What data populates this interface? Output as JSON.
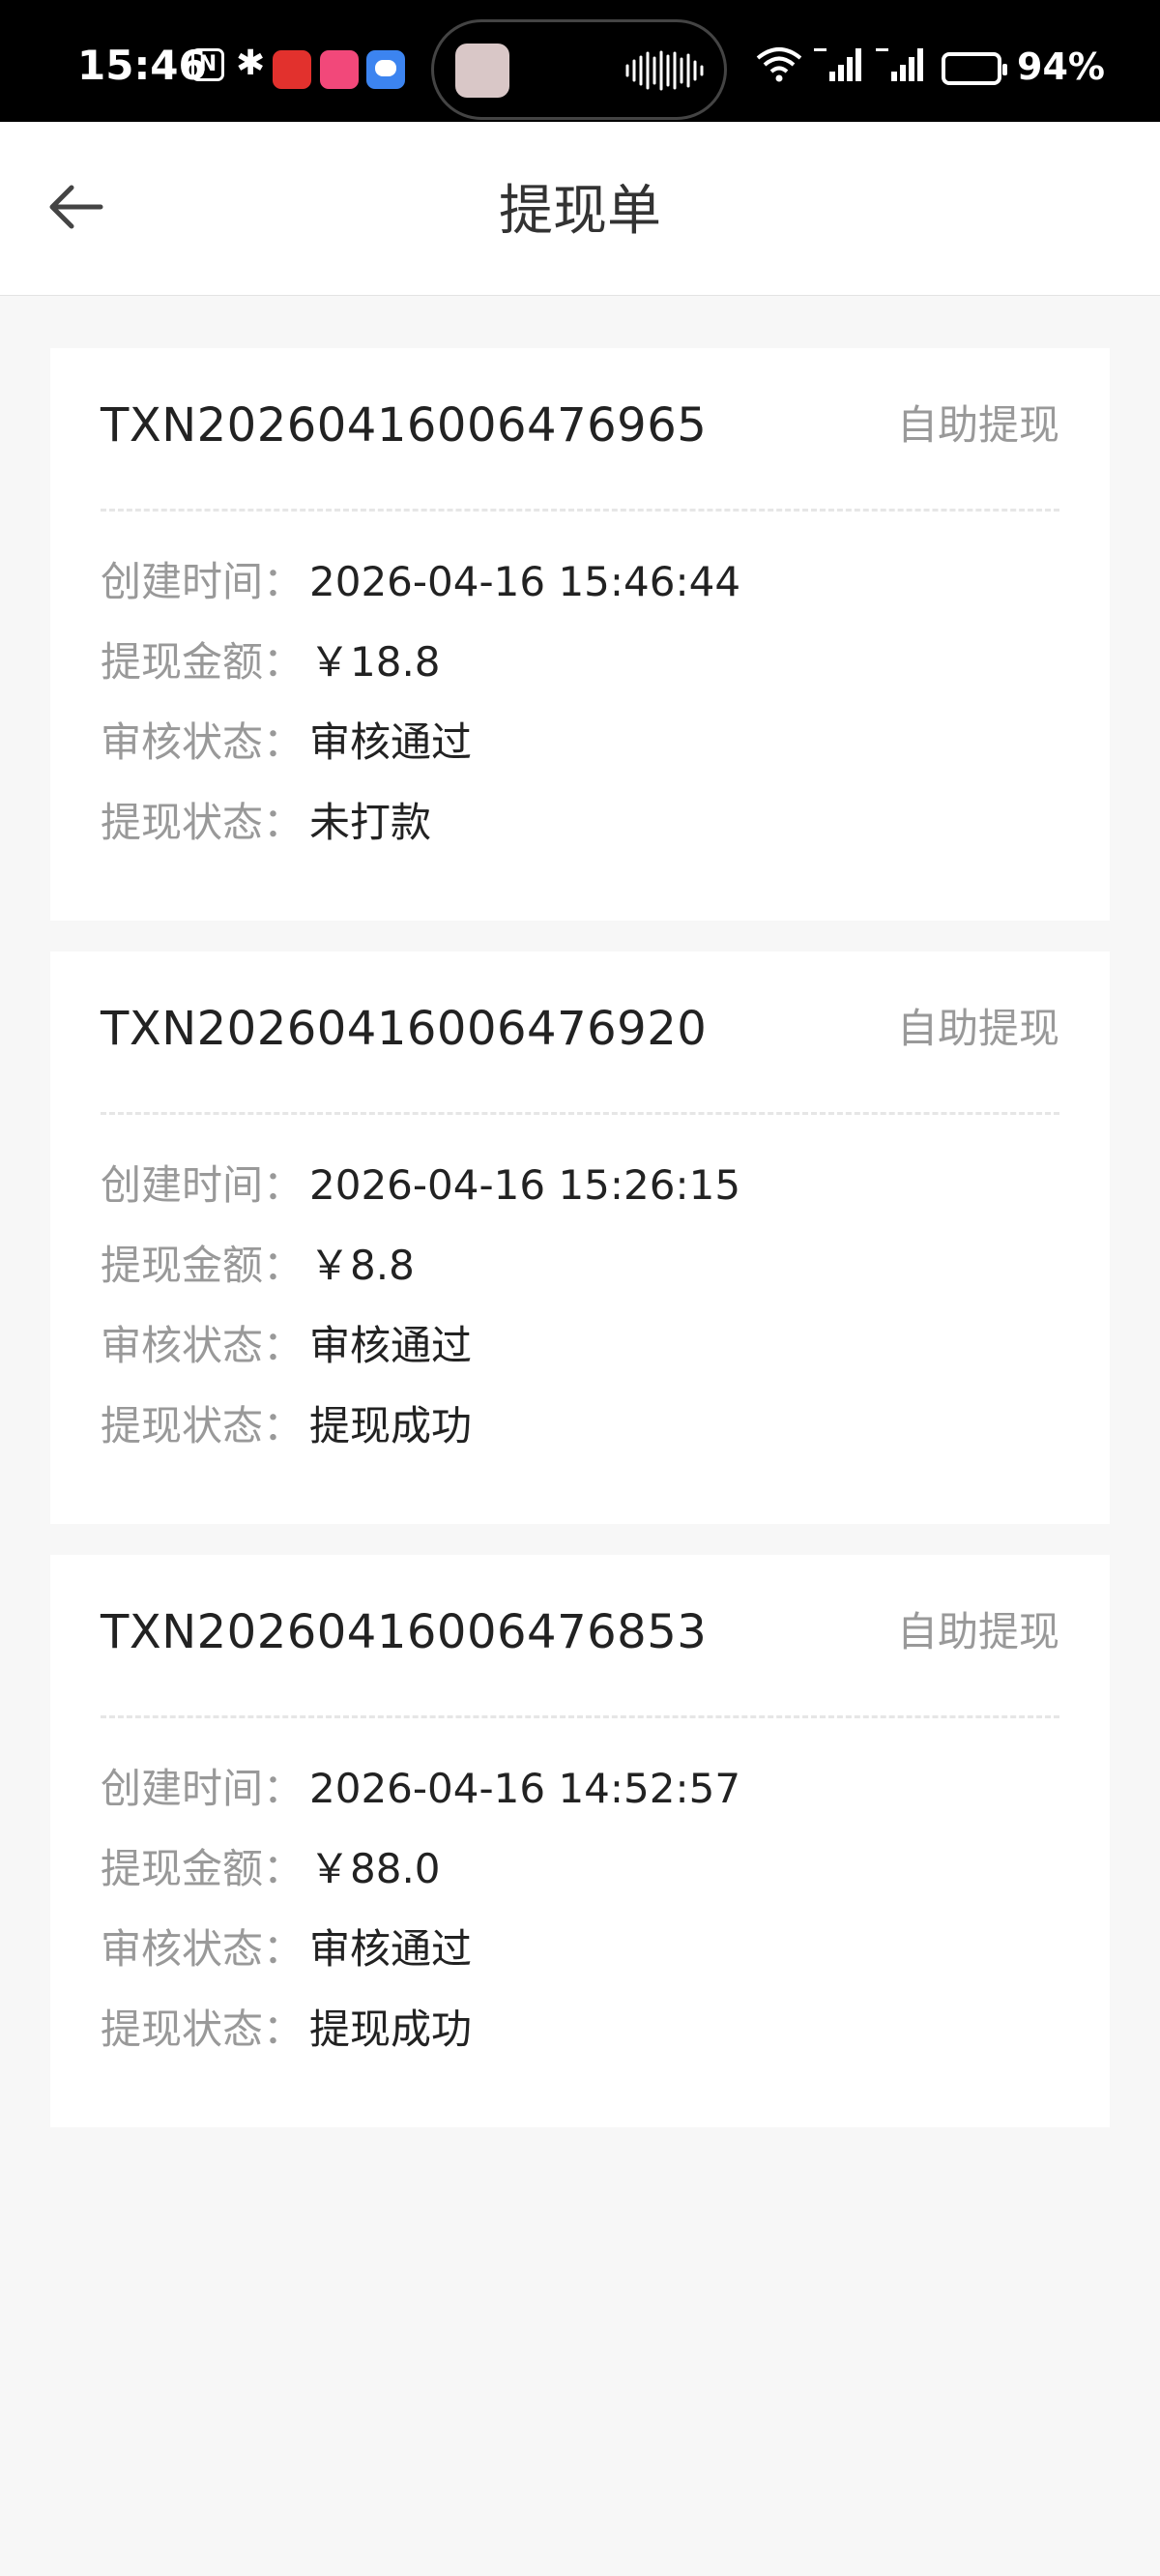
{
  "status_bar": {
    "time": "15:46",
    "nfc_label": "N",
    "bluetooth_symbol": "✱",
    "battery_percent": "94%",
    "icons": [
      "nfc-icon",
      "bluetooth-icon",
      "app-notification-icon",
      "app-notification-icon",
      "message-icon",
      "media-thumbnail",
      "audio-wave-icon",
      "wifi-icon",
      "signal-5g-icon",
      "signal-5g-icon",
      "battery-charging-icon"
    ]
  },
  "header": {
    "title": "提现单",
    "back_icon": "arrow-left-icon"
  },
  "labels": {
    "created_time": "创建时间：",
    "amount": "提现金额：",
    "review_status": "审核状态：",
    "withdraw_status": "提现状态："
  },
  "orders": [
    {
      "order_no": "TXN20260416006476965",
      "type": "自助提现",
      "created_time": "2026-04-16 15:46:44",
      "amount": "￥18.8",
      "review_status": "审核通过",
      "withdraw_status": "未打款"
    },
    {
      "order_no": "TXN20260416006476920",
      "type": "自助提现",
      "created_time": "2026-04-16 15:26:15",
      "amount": "￥8.8",
      "review_status": "审核通过",
      "withdraw_status": "提现成功"
    },
    {
      "order_no": "TXN20260416006476853",
      "type": "自助提现",
      "created_time": "2026-04-16 14:52:57",
      "amount": "￥88.0",
      "review_status": "审核通过",
      "withdraw_status": "提现成功"
    }
  ],
  "colors": {
    "page_background": "#f7f7f7",
    "card_background": "#ffffff",
    "label_gray": "#999999",
    "text_dark": "#222222"
  }
}
